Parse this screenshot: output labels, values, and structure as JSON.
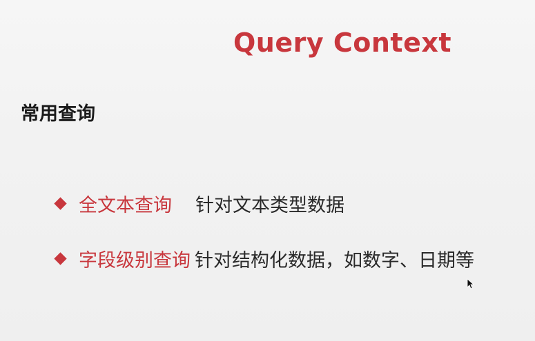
{
  "slide": {
    "title": "Query Context",
    "section_heading": "常用查询",
    "bullets": [
      {
        "term": "全文本查询",
        "description": "针对文本类型数据"
      },
      {
        "term": "字段级别查询",
        "description": "针对结构化数据，如数字、日期等"
      }
    ]
  },
  "colors": {
    "accent": "#c8373d",
    "text": "#1b1b1b",
    "background": "#f2f2f2"
  },
  "icons": {
    "bullet": "diamond-bullet-icon",
    "pointer": "mouse-pointer-icon"
  }
}
